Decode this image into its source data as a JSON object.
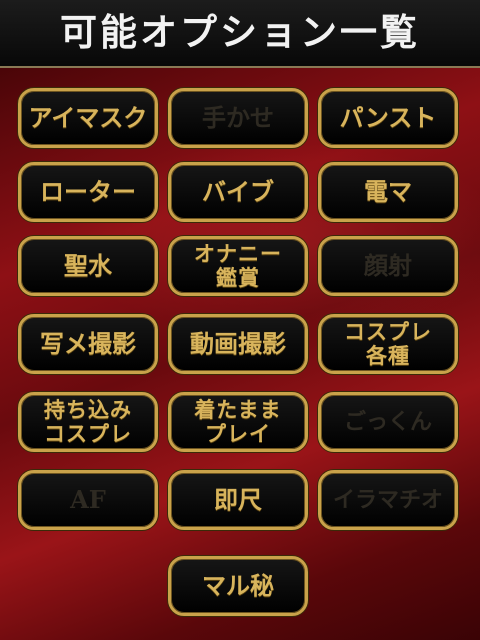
{
  "header": {
    "title": "可能オプション一覧"
  },
  "options": [
    {
      "label": "アイマスク",
      "available": true
    },
    {
      "label": "手かせ",
      "available": false
    },
    {
      "label": "パンスト",
      "available": true
    },
    {
      "label": "ローター",
      "available": true
    },
    {
      "label": "バイブ",
      "available": true
    },
    {
      "label": "電マ",
      "available": true
    },
    {
      "label": "聖水",
      "available": true
    },
    {
      "label": "オナニー\n鑑賞",
      "available": true
    },
    {
      "label": "顔射",
      "available": false
    },
    {
      "label": "写メ撮影",
      "available": true
    },
    {
      "label": "動画撮影",
      "available": true
    },
    {
      "label": "コスプレ\n各種",
      "available": true
    },
    {
      "label": "持ち込み\nコスプレ",
      "available": true
    },
    {
      "label": "着たまま\nプレイ",
      "available": true
    },
    {
      "label": "ごっくん",
      "available": false
    },
    {
      "label": "AF",
      "available": false
    },
    {
      "label": "即尺",
      "available": true
    },
    {
      "label": "イラマチオ",
      "available": false
    },
    {
      "label": "マル秘",
      "available": true
    }
  ]
}
